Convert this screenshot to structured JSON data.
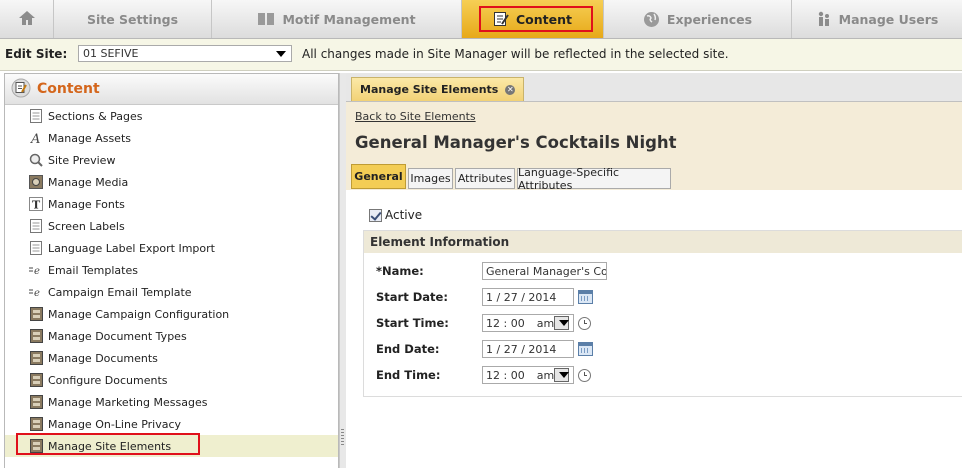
{
  "topnav": {
    "home_icon": "home-icon",
    "tabs": [
      {
        "label": "Site Settings",
        "icon": ""
      },
      {
        "label": "Motif Management",
        "icon": "book-icon"
      },
      {
        "label": "Content",
        "icon": "content-edit-icon"
      },
      {
        "label": "Experiences",
        "icon": "globe-icon"
      },
      {
        "label": "Manage Users",
        "icon": "users-icon"
      }
    ],
    "active_tab": "Content"
  },
  "sitebar": {
    "label": "Edit Site:",
    "selected_site": "01 SEFIVE",
    "message": "All changes made in Site Manager will be reflected in the selected site."
  },
  "sidebar": {
    "title": "Content",
    "items": [
      {
        "label": "Sections & Pages",
        "icon": "page-icon"
      },
      {
        "label": "Manage Assets",
        "icon": "font-a-icon"
      },
      {
        "label": "Site Preview",
        "icon": "magnifier-icon"
      },
      {
        "label": "Manage Media",
        "icon": "media-icon"
      },
      {
        "label": "Manage Fonts",
        "icon": "font-t-icon"
      },
      {
        "label": "Screen Labels",
        "icon": "page-icon"
      },
      {
        "label": "Language Label Export Import",
        "icon": "page-icon"
      },
      {
        "label": "Email Templates",
        "icon": "email-e-icon"
      },
      {
        "label": "Campaign Email Template",
        "icon": "email-e-icon"
      },
      {
        "label": "Manage Campaign Configuration",
        "icon": "cabinet-icon"
      },
      {
        "label": "Manage Document Types",
        "icon": "cabinet-icon"
      },
      {
        "label": "Manage Documents",
        "icon": "cabinet-icon"
      },
      {
        "label": "Configure Documents",
        "icon": "cabinet-icon"
      },
      {
        "label": "Manage Marketing Messages",
        "icon": "cabinet-icon"
      },
      {
        "label": "Manage On-Line Privacy",
        "icon": "cabinet-icon"
      },
      {
        "label": "Manage Site Elements",
        "icon": "cabinet-icon"
      }
    ],
    "selected_item": "Manage Site Elements"
  },
  "main": {
    "tab_label": "Manage Site Elements",
    "back_link": "Back to Site Elements",
    "page_title": "General Manager's Cocktails Night",
    "subtabs": [
      "General",
      "Images",
      "Attributes",
      "Language-Specific Attributes"
    ],
    "active_subtab": "General",
    "active_label": "Active",
    "active_checked": true,
    "section_title": "Element Information",
    "fields": {
      "name": {
        "label": "*Name:",
        "value": "General Manager's Cocktails Night"
      },
      "start_date": {
        "label": "Start Date:",
        "value": "1 / 27 / 2014"
      },
      "start_time": {
        "label": "Start Time:",
        "value": "12 : 00",
        "ampm": "am"
      },
      "end_date": {
        "label": "End Date:",
        "value": "1 / 27 / 2014"
      },
      "end_time": {
        "label": "End Time:",
        "value": "12 : 00",
        "ampm": "am"
      }
    }
  },
  "colors": {
    "accent_active_tab": "#f3cd55",
    "highlight_box": "#e0101b",
    "sidebar_title": "#d4661c"
  }
}
